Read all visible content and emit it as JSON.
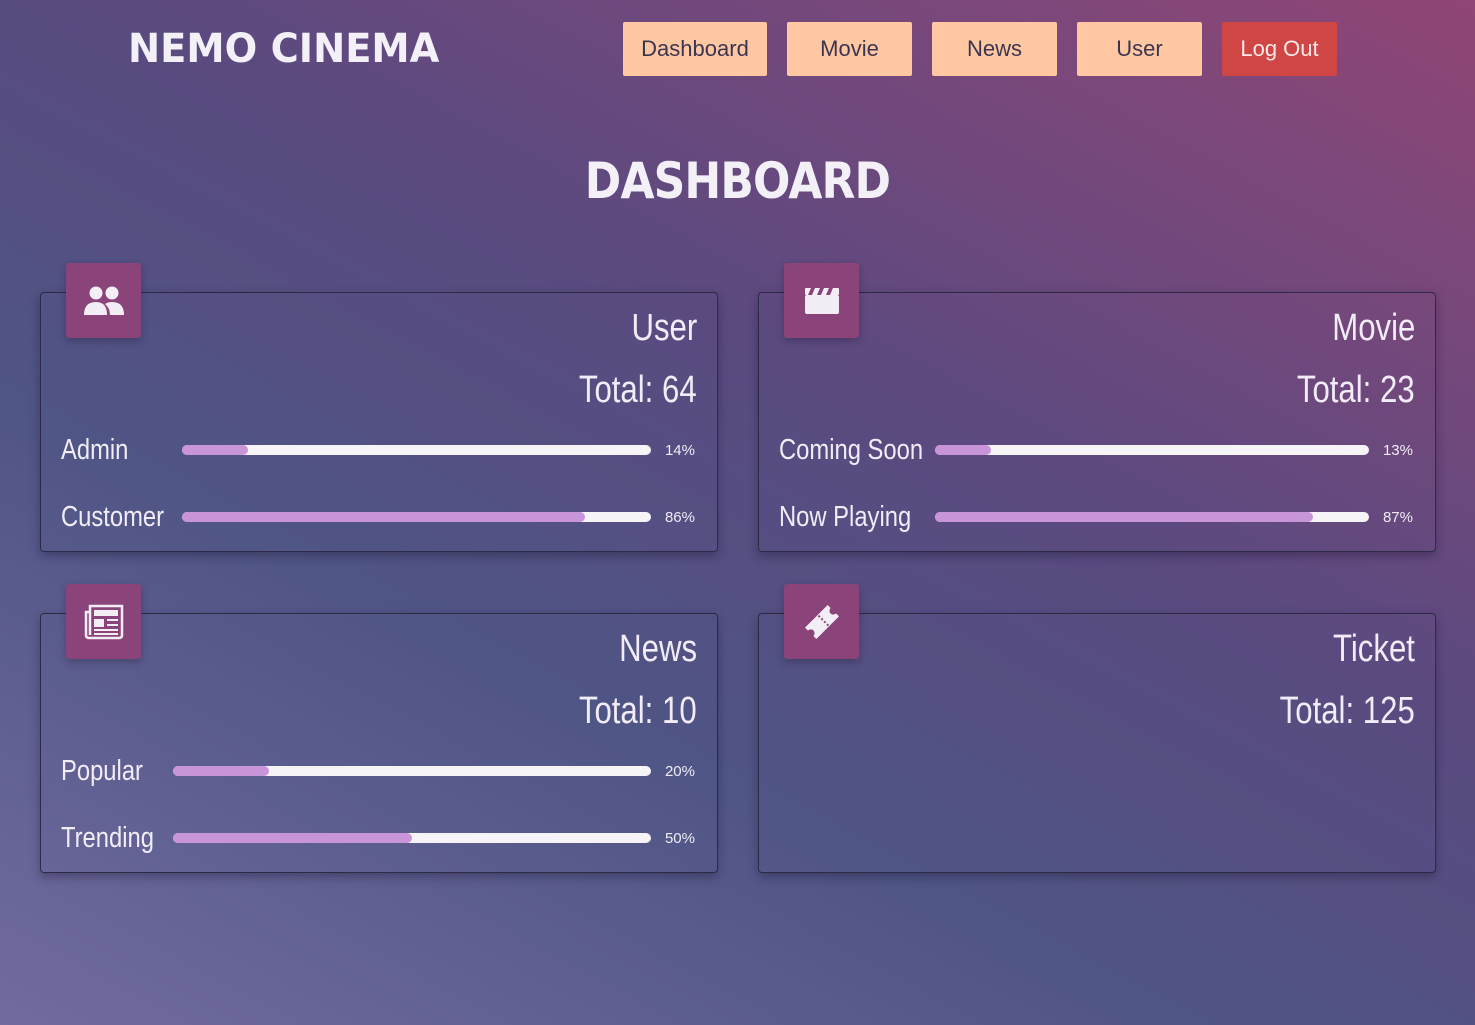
{
  "header": {
    "brand": "NEMO CINEMA",
    "nav": [
      {
        "label": "Dashboard"
      },
      {
        "label": "Movie"
      },
      {
        "label": "News"
      },
      {
        "label": "User"
      },
      {
        "label": "Log Out"
      }
    ]
  },
  "page_title": "DASHBOARD",
  "cards": [
    {
      "title": "User",
      "total": "Total: 64",
      "icon": "users-icon",
      "stats": [
        {
          "label": "Admin",
          "pct_text": "14%",
          "value": 14
        },
        {
          "label": "Customer",
          "pct_text": "86%",
          "value": 86
        }
      ]
    },
    {
      "title": "Movie",
      "total": "Total: 23",
      "icon": "clapperboard-icon",
      "stats": [
        {
          "label": "Coming Soon",
          "pct_text": "13%",
          "value": 13
        },
        {
          "label": "Now Playing",
          "pct_text": "87%",
          "value": 87
        }
      ]
    },
    {
      "title": "News",
      "total": "Total: 10",
      "icon": "newspaper-icon",
      "stats": [
        {
          "label": "Popular",
          "pct_text": "20%",
          "value": 20
        },
        {
          "label": "Trending",
          "pct_text": "50%",
          "value": 50
        }
      ]
    },
    {
      "title": "Ticket",
      "total": "Total: 125",
      "icon": "ticket-icon",
      "stats": []
    }
  ],
  "colors": {
    "nav_button": "#ffc8a3",
    "logout_button": "#d04645",
    "icon_tile": "#8a4479",
    "progress_fill": "#c995d9",
    "progress_track": "#f6f4f9"
  }
}
